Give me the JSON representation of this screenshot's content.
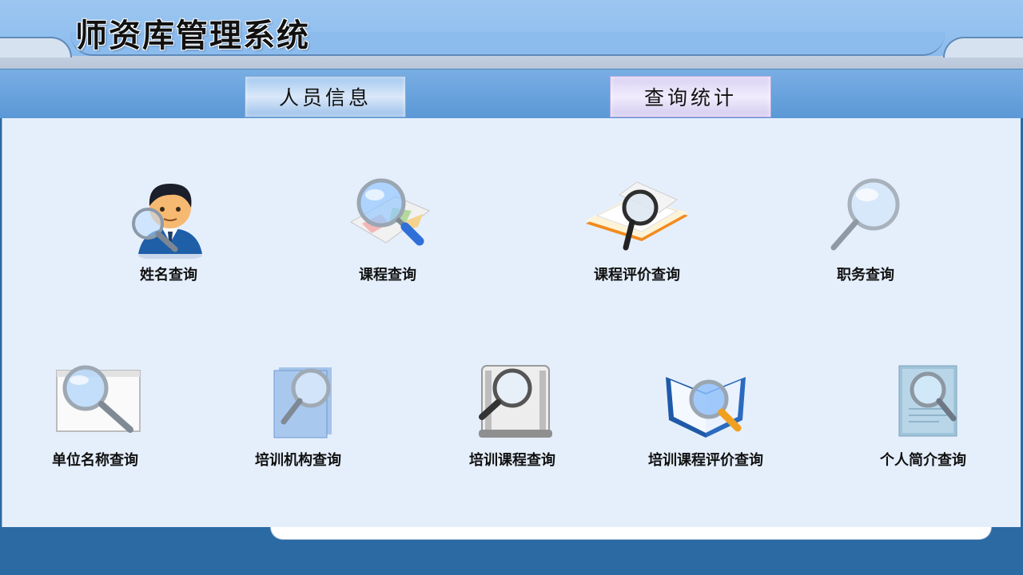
{
  "app": {
    "title": "师资库管理系统"
  },
  "nav": {
    "people_info": "人员信息",
    "query_stats": "查询统计"
  },
  "queries": [
    {
      "label": "姓名查询",
      "icon": "person-magnifier-icon"
    },
    {
      "label": "课程查询",
      "icon": "map-magnifier-icon"
    },
    {
      "label": "课程评价查询",
      "icon": "book-magnifier-icon"
    },
    {
      "label": "职务查询",
      "icon": "magnifier-icon"
    },
    {
      "label": "单位名称查询",
      "icon": "window-magnifier-icon"
    },
    {
      "label": "培训机构查询",
      "icon": "folder-magnifier-icon"
    },
    {
      "label": "培训课程查询",
      "icon": "film-magnifier-icon"
    },
    {
      "label": "培训课程评价查询",
      "icon": "open-book-magnifier-icon"
    },
    {
      "label": "个人简介查询",
      "icon": "document-magnifier-icon"
    }
  ]
}
